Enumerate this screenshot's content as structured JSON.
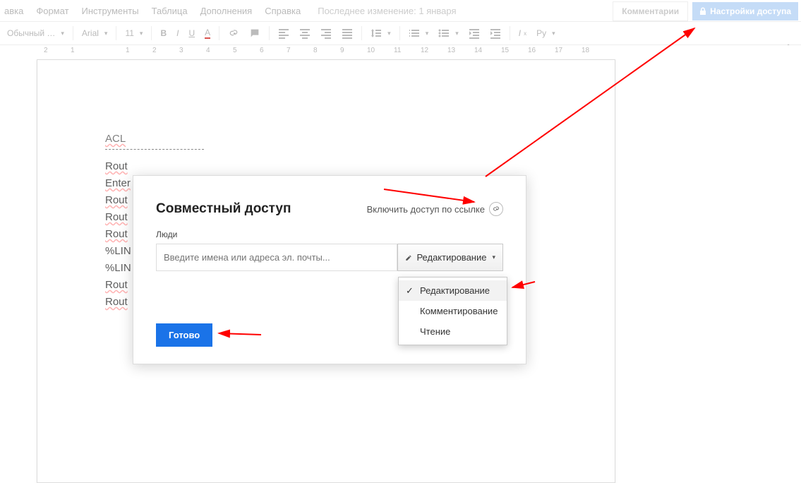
{
  "menu": {
    "items": [
      "авка",
      "Формат",
      "Инструменты",
      "Таблица",
      "Дополнения",
      "Справка"
    ]
  },
  "last_edit": "Последнее изменение: 1 января",
  "buttons": {
    "comments": "Комментарии",
    "share": "Настройки доступа"
  },
  "toolbar": {
    "style": "Обычный …",
    "font": "Arial",
    "size": "11",
    "lang": "Ру"
  },
  "doc": {
    "title": "ACL",
    "lines": [
      "Rout",
      "Enter",
      "Rout",
      "Rout",
      "",
      "Rout",
      "",
      "%LIN",
      "",
      "%LIN",
      "",
      "Rout",
      "Rout"
    ]
  },
  "modal": {
    "title": "Совместный доступ",
    "link_toggle": "Включить доступ по ссылке",
    "people_label": "Люди",
    "people_placeholder": "Введите имена или адреса эл. почты...",
    "perm_label": "Редактирование",
    "done": "Готово"
  },
  "dropdown": {
    "items": [
      "Редактирование",
      "Комментирование",
      "Чтение"
    ],
    "selected": 0
  },
  "ruler": {
    "marks": [
      "2",
      "1",
      "",
      "1",
      "2",
      "3",
      "4",
      "5",
      "6",
      "7",
      "8",
      "9",
      "10",
      "11",
      "12",
      "13",
      "14",
      "15",
      "16",
      "17",
      "18"
    ]
  }
}
